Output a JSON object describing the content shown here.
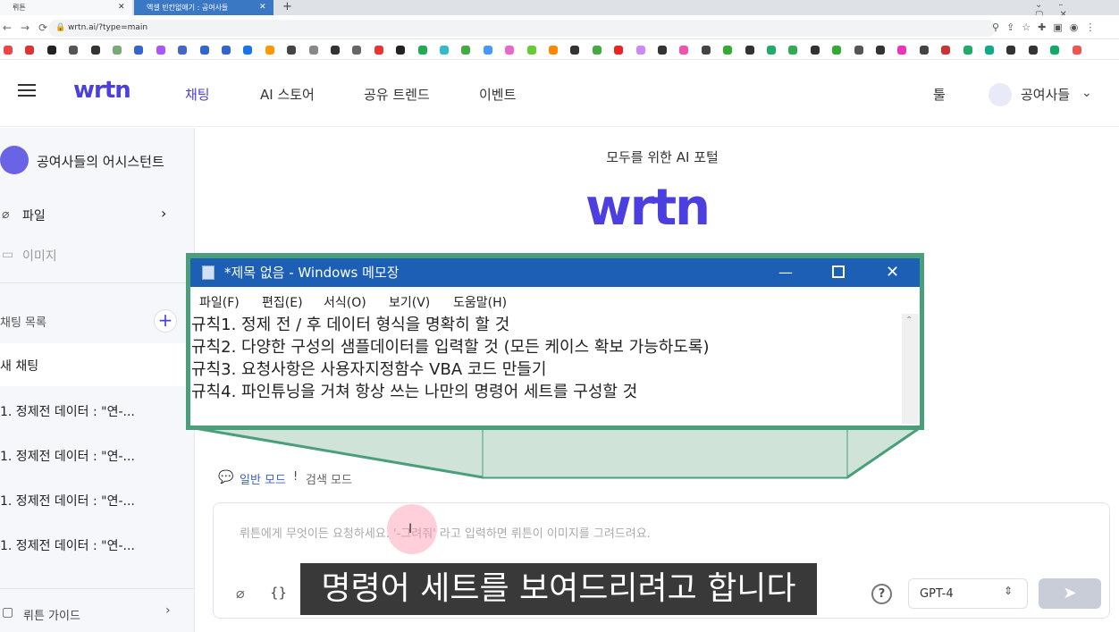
{
  "browser": {
    "tabs": [
      {
        "label": "뤼튼"
      },
      {
        "label": "엑셀 빈칸없애기 : 공여사들"
      }
    ],
    "url": "wrtn.ai/?type=main"
  },
  "colors": {
    "brand": "#4b3fe0",
    "notepad_title": "#1c5fb4",
    "highlight_border": "#4a9f7a"
  },
  "header": {
    "logo": "wrtn",
    "nav": [
      "채팅",
      "AI 스토어",
      "공유 트렌드",
      "이벤트"
    ],
    "tools": "툴",
    "user": "공여사들"
  },
  "sidebar": {
    "assistant": "공여사들의 어시스턴트",
    "file": "파일",
    "image": "이미지",
    "chat_list": "채팅 목록",
    "new_chat": "새 채팅",
    "chats": [
      "1. 정제전 데이터 : \"연-...",
      "1. 정제전 데이터 : \"연-...",
      "1. 정제전 데이터 : \"연-...",
      "1. 정제전 데이터 : \"연-..."
    ],
    "guide": "뤼튼 가이드"
  },
  "main": {
    "tagline": "모두를 위한 AI 포털",
    "logo": "wrtn",
    "mode_normal": "일반 모드",
    "mode_sep": "!",
    "mode_search": "검색 모드",
    "placeholder": "뤼튼에게 무엇이든 요청하세요. '-그려줘' 라고 입력하면 뤼튼이 이미지를 그려드려요.",
    "model": "GPT-4"
  },
  "notepad": {
    "title": "*제목 없음 - Windows 메모장",
    "menu": [
      "파일(F)",
      "편집(E)",
      "서식(O)",
      "보기(V)",
      "도움말(H)"
    ],
    "lines": [
      "규칙1. 정제 전 / 후 데이터 형식을 명확히 할 것",
      "규칙2. 다양한 구성의 샘플데이터를 입력할 것 (모든 케이스 확보 가능하도록)",
      "규칙3. 요청사항은 사용자지정함수 VBA 코드 만들기",
      "규칙4. 파인튜닝을 거쳐 항상 쓰는 나만의 명령어 세트를 구성할 것"
    ]
  },
  "subtitle": "명령어 세트를 보여드리려고 합니다"
}
